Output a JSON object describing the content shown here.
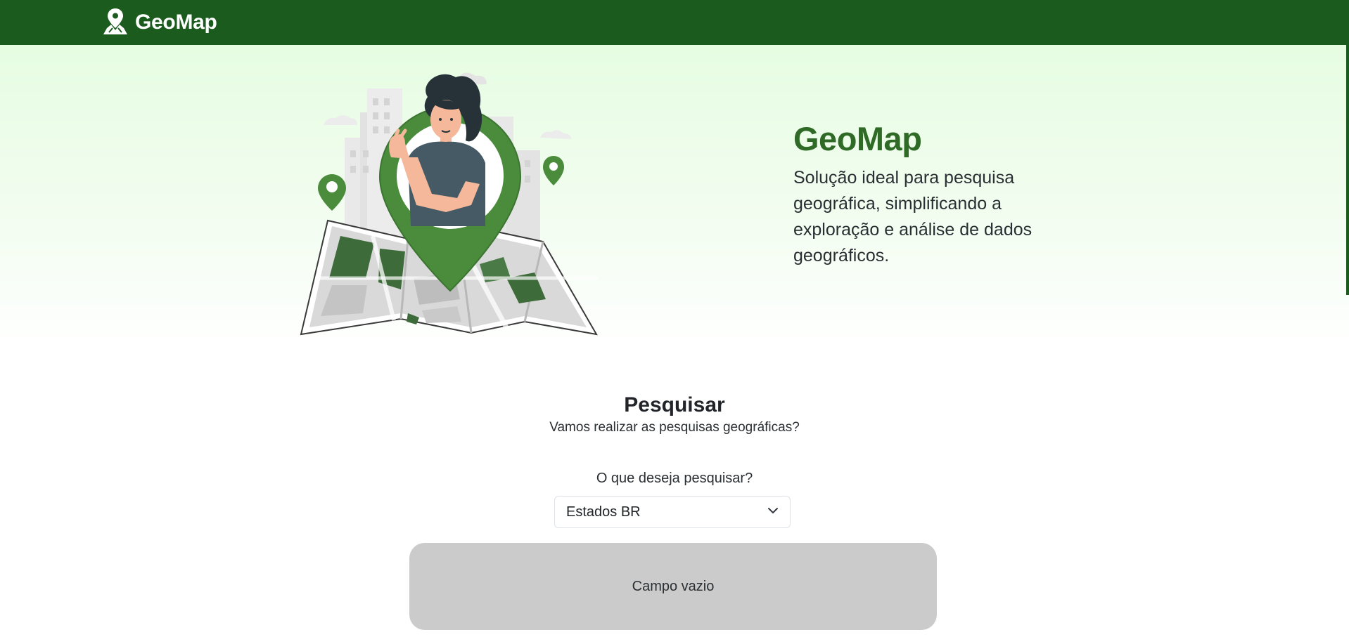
{
  "navbar": {
    "brand_text": "GeoMap",
    "brand_icon": "map-pin-icon"
  },
  "hero": {
    "title": "GeoMap",
    "description": "Solução ideal para pesquisa geográfica, simplificando a exploração e análise de dados geográficos.",
    "illustration": "woman-in-map-pin-illustration"
  },
  "search": {
    "title": "Pesquisar",
    "subtitle": "Vamos realizar as pesquisas geográficas?",
    "field_label": "O que deseja pesquisar?",
    "selected_option": "Estados BR",
    "dropdown_icon": "chevron-down-icon",
    "result_text": "Campo vazio"
  },
  "colors": {
    "navbar_bg": "#1b5b1e",
    "hero_title": "#2f6a27",
    "pin_green": "#4a8b3c",
    "result_panel_bg": "#cbcbcb"
  }
}
